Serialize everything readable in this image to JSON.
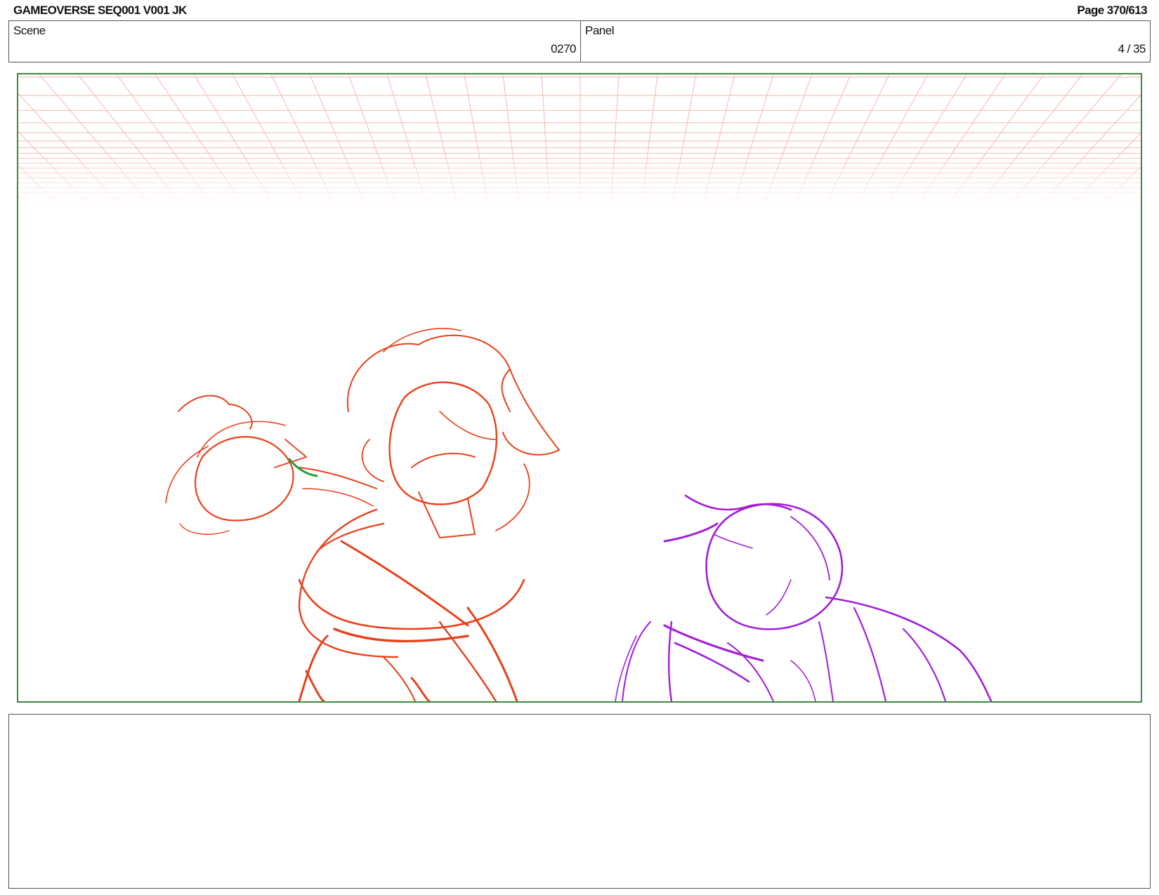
{
  "header": {
    "title": "GAMEOVERSE SEQ001 V001 JK",
    "page": "Page 370/613"
  },
  "info": {
    "scene_label": "Scene",
    "scene_value": "0270",
    "panel_label": "Panel",
    "panel_value": "4 / 35"
  },
  "colors": {
    "frame_border": "#3e8a3e",
    "grid": "#f6c4bc",
    "character_left": "#e8411a",
    "character_right": "#a21fd6",
    "accent_mark": "#1f9e3a"
  },
  "notes": {
    "text": ""
  }
}
